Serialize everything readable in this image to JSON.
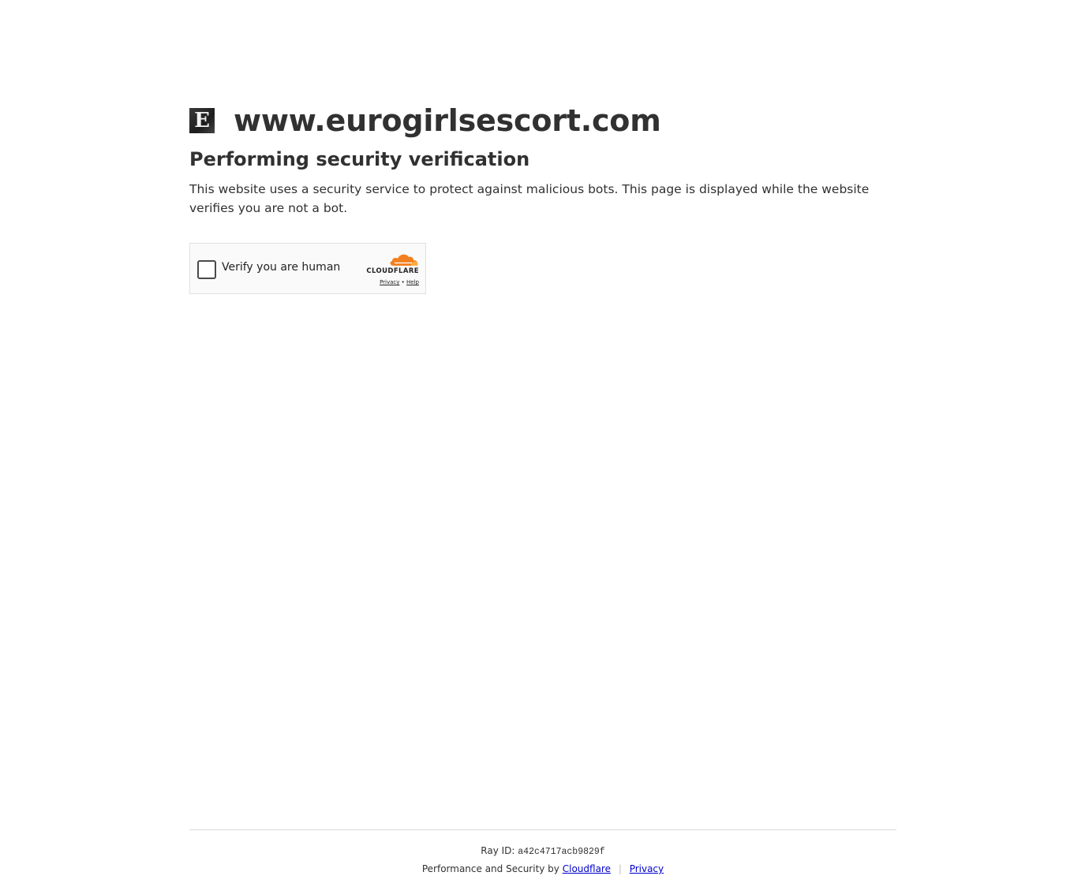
{
  "header": {
    "site_logo_letter": "E",
    "site_name": "www.eurogirlsescort.com"
  },
  "main": {
    "heading": "Performing security verification",
    "description": "This website uses a security service to protect against malicious bots. This page is displayed while the website verifies you are not a bot."
  },
  "challenge": {
    "checkbox_label": "Verify you are human",
    "brand_icon": "cloudflare-cloud-icon",
    "brand_name": "CLOUDFLARE",
    "privacy_link": "Privacy",
    "link_separator": "•",
    "help_link": "Help",
    "brand_color": "#f38020"
  },
  "footer": {
    "ray_label": "Ray ID:",
    "ray_id": "a42c4717acb9829f",
    "perf_text": "Performance and Security by",
    "cloudflare_link": "Cloudflare",
    "separator": "|",
    "privacy_link": "Privacy",
    "link_color": "#0000cc"
  }
}
